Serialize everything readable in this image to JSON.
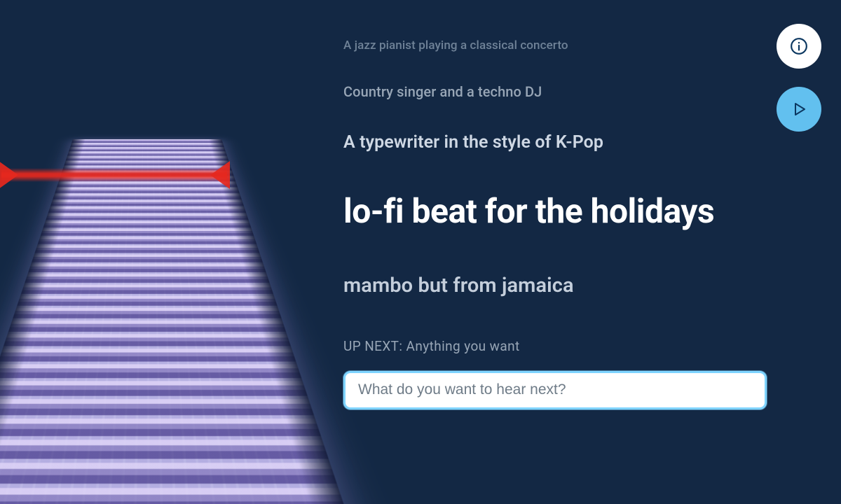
{
  "prompts": {
    "xs": "A jazz pianist playing a classical concerto",
    "sm": "Country singer and a techno DJ",
    "md": "A typewriter in the style of K-Pop",
    "lg": "lo-fi beat for the holidays",
    "msm": "mambo but from jamaica"
  },
  "up_next_label": "UP NEXT: Anything you want",
  "input": {
    "placeholder": "What do you want to hear next?",
    "value": ""
  },
  "buttons": {
    "info_aria": "Info",
    "play_aria": "Play"
  },
  "colors": {
    "background": "#132844",
    "accent": "#62c0ef",
    "scanline": "#e6281e"
  }
}
